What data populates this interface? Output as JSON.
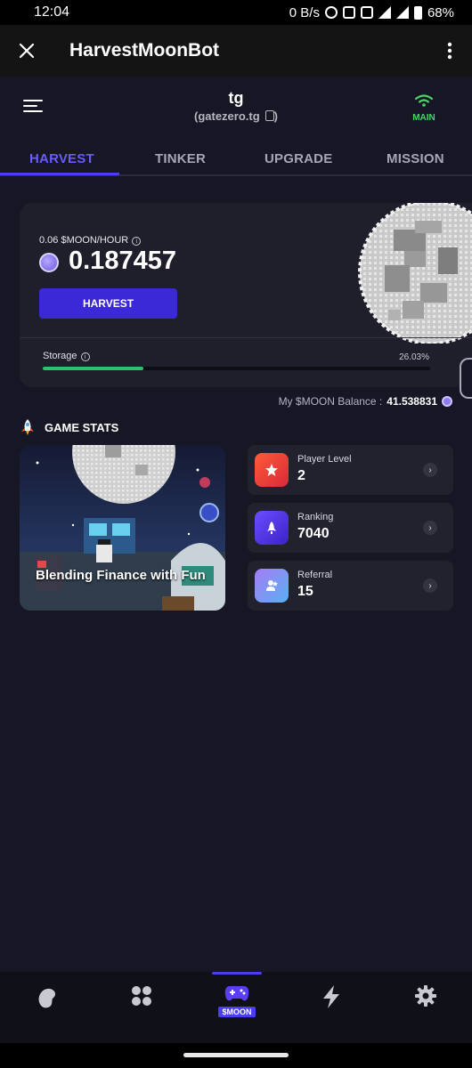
{
  "status_bar": {
    "time": "12:04",
    "net_speed": "0 B/s",
    "battery": "68%"
  },
  "app_bar": {
    "title": "HarvestMoonBot"
  },
  "header": {
    "username": "tg",
    "handle": "(gatezero.tg",
    "handle_close": ")",
    "network_label": "MAIN"
  },
  "tabs": [
    {
      "label": "HARVEST",
      "active": true
    },
    {
      "label": "TINKER",
      "active": false
    },
    {
      "label": "UPGRADE",
      "active": false
    },
    {
      "label": "MISSION",
      "active": false
    }
  ],
  "harvest_card": {
    "rate": "0.06 $MOON/HOUR",
    "amount": "0.187457",
    "harvest_button": "HARVEST",
    "storage_label": "Storage",
    "storage_percent": "26.03%",
    "storage_fill": 0.2603
  },
  "balance": {
    "label": "My $MOON Balance :",
    "value": "41.538831"
  },
  "game_stats": {
    "title": "GAME STATS",
    "image_caption": "Blending Finance with Fun",
    "items": [
      {
        "label": "Player Level",
        "value": "2",
        "icon": "star-icon",
        "color": "#f04a3c"
      },
      {
        "label": "Ranking",
        "value": "7040",
        "icon": "rocket-icon",
        "color": "#5b3df0"
      },
      {
        "label": "Referral",
        "value": "15",
        "icon": "person-icon",
        "color": "#8a7cf5"
      }
    ]
  },
  "bottom_nav": {
    "active_badge": "$MOON",
    "items": [
      "bean-icon",
      "apps-grid-icon",
      "gamepad-icon",
      "bolt-icon",
      "gear-icon"
    ]
  },
  "colors": {
    "accent": "#4b3df0",
    "background": "#161624",
    "card": "#1f1f2c",
    "storage_green": "#2fc06a",
    "network_green": "#4ad36b"
  }
}
